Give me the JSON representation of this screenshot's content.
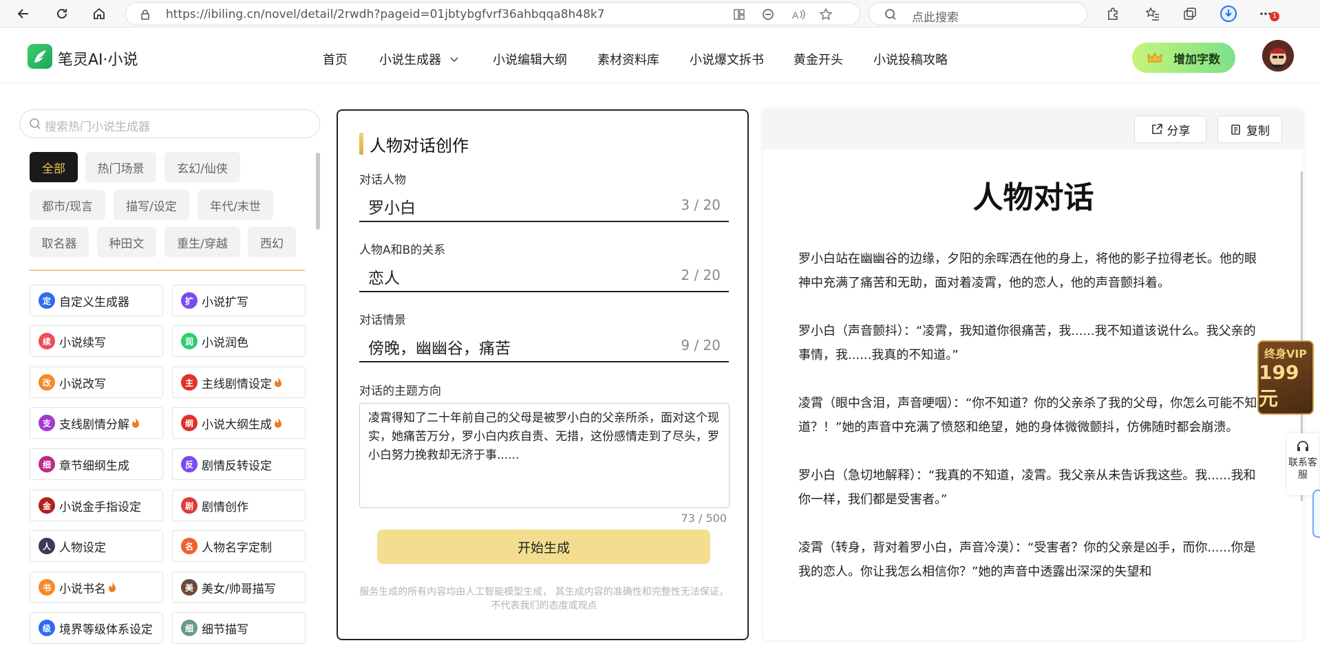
{
  "browser": {
    "url": "https://ibiling.cn/novel/detail/2rwdh?pageid=01jbtybgfvrf36ahbqqa8h48k7",
    "search_placeholder": "点此搜索",
    "notification_count": "1"
  },
  "site": {
    "logo_text": "笔灵AI·小说",
    "nav": [
      "首页",
      "小说生成器",
      "小说编辑大纲",
      "素材资料库",
      "小说爆文拆书",
      "黄金开头",
      "小说投稿攻略"
    ],
    "add_words_label": "增加字数"
  },
  "sidebar": {
    "search_placeholder": "搜索热门小说生成器",
    "categories": [
      "全部",
      "热门场景",
      "玄幻/仙侠",
      "都市/现言",
      "描写/设定",
      "年代/末世",
      "取名器",
      "种田文",
      "重生/穿越",
      "西幻"
    ],
    "active_category": "全部",
    "tools": [
      {
        "label": "自定义生成器",
        "icon": "定",
        "color": "#2f6bf0",
        "hot": false
      },
      {
        "label": "小说扩写",
        "icon": "扩",
        "color": "#7a4cf0",
        "hot": false
      },
      {
        "label": "小说续写",
        "icon": "续",
        "color": "#f04a5a",
        "hot": false
      },
      {
        "label": "小说润色",
        "icon": "润",
        "color": "#2ecc71",
        "hot": false
      },
      {
        "label": "小说改写",
        "icon": "改",
        "color": "#f58a2a",
        "hot": false
      },
      {
        "label": "主线剧情设定",
        "icon": "主",
        "color": "#e0312a",
        "hot": true
      },
      {
        "label": "支线剧情分解",
        "icon": "支",
        "color": "#a03ad0",
        "hot": true
      },
      {
        "label": "小说大纲生成",
        "icon": "纲",
        "color": "#e0312a",
        "hot": true
      },
      {
        "label": "章节细纲生成",
        "icon": "细",
        "color": "#c0288a",
        "hot": false
      },
      {
        "label": "剧情反转设定",
        "icon": "反",
        "color": "#7a4cf0",
        "hot": false
      },
      {
        "label": "小说金手指设定",
        "icon": "金",
        "color": "#b02020",
        "hot": false
      },
      {
        "label": "剧情创作",
        "icon": "剧",
        "color": "#e03a3a",
        "hot": false
      },
      {
        "label": "人物设定",
        "icon": "人",
        "color": "#3a3a5a",
        "hot": false
      },
      {
        "label": "人物名字定制",
        "icon": "名",
        "color": "#f06030",
        "hot": false
      },
      {
        "label": "小说书名",
        "icon": "书",
        "color": "#f58a2a",
        "hot": true
      },
      {
        "label": "美女/帅哥描写",
        "icon": "美",
        "color": "#6a4a3a",
        "hot": false
      },
      {
        "label": "境界等级体系设定",
        "icon": "级",
        "color": "#2f6bf0",
        "hot": false
      },
      {
        "label": "细节描写",
        "icon": "细",
        "color": "#6a9a8a",
        "hot": false
      }
    ]
  },
  "form": {
    "title": "人物对话创作",
    "field1_label": "对话人物",
    "field1_value": "罗小白",
    "field1_count": "3 / 20",
    "field2_label": "人物A和B的关系",
    "field2_value": "恋人",
    "field2_count": "2 / 20",
    "field3_label": "对话情景",
    "field3_value": "傍晚，幽幽谷，痛苦",
    "field3_count": "9 / 20",
    "field4_label": "对话的主题方向",
    "field4_value": "凌霄得知了二十年前自己的父母是被罗小白的父亲所杀，面对这个现实，她痛苦万分，罗小白内疚自责、无措，这份感情走到了尽头，罗小白努力挽救却无济于事......",
    "field4_count": "73 / 500",
    "generate_label": "开始生成",
    "disclaimer": "服务生成的所有内容均由人工智能模型生成， 其生成内容的准确性和完整性无法保证， 不代表我们的态度或观点"
  },
  "output": {
    "share_label": "分享",
    "copy_label": "复制",
    "title": "人物对话",
    "paragraphs": [
      "罗小白站在幽幽谷的边缘，夕阳的余晖洒在他的身上，将他的影子拉得老长。他的眼神中充满了痛苦和无助，面对着凌霄，他的恋人，他的声音颤抖着。",
      "罗小白（声音颤抖）：“凌霄，我知道你很痛苦，我......我不知道该说什么。我父亲的事情，我......我真的不知道。”",
      "凌霄（眼中含泪，声音哽咽）：“你不知道？你的父亲杀了我的父母，你怎么可能不知道？！”她的声音中充满了愤怒和绝望，她的身体微微颤抖，仿佛随时都会崩溃。",
      "罗小白（急切地解释）：“我真的不知道，凌霄。我父亲从未告诉我这些。我......我和你一样，我们都是受害者。”",
      "凌霄（转身，背对着罗小白，声音冷漠）：“受害者？你的父亲是凶手，而你......你是我的恋人。你让我怎么相信你？”她的声音中透露出深深的失望和"
    ]
  },
  "floating": {
    "vip_line1": "终身VIP",
    "vip_line2": "199元",
    "service_label": "联系客服"
  }
}
